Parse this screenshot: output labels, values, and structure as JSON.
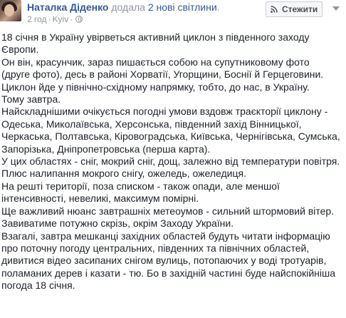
{
  "post": {
    "author": "Наталка Діденко",
    "action": " додала ",
    "photos_link": "2 нові світлини",
    "action_suffix": ".",
    "time": "2 год",
    "location": "Kyiv",
    "follow_label": "Стежити",
    "icons": {
      "avatar": "avatar-photo",
      "privacy": "globe-icon",
      "follow": "rss-icon",
      "more": "chevron-down-icon"
    },
    "colors": {
      "author_link": "#365899",
      "meta": "#90949c",
      "text": "#1d2129"
    },
    "paragraphs": [
      "18 січня в Україну увірветься активний циклон з південного заходу\nЄвропи.",
      "Он він, красунчик, зараз пишається собою на супутниковому фото\n(друге фото), десь в районі Хорватії, Угорщини, Боснії й Герцеговини.",
      "Циклон йде у північно-східному напрямку, тобто, до нас, в Україну.",
      "Тому завтра.",
      "Найскладнішими очікується погодні умови вздовж траєкторії циклону -\nОдеська, Миколаївська, Херсонська, південний захід Вінницької,\nЧеркаська, Полтавська, Кіровоградська, Київська, Чернігівська, Сумська,\nЗапорізька, Дніпропетровська (перша карта).",
      "У цих областях - сніг, мокрий сніг, дощ, залежно від температури повітря.",
      "Плюс налипання мокрого снігу, ожеледь, ожеледиця.",
      "На решті території, поза списком - також опади, але меншої\nінтенсивності, невеликі, максимум помірні.",
      "Ще важливий нюанс завтрашніх метеоумов - сильний штормовий вітер.",
      "Завиватиме потужно скрізь, окрім Заходу України.",
      "Взагалі, завтра мешканці західних областей будуть читати інформацію\nпро поточну погоду центральних, південних та північних областей,\nдивитися відео засипаних снігом вулиць, потопаючих у воді тротуарів,\nполаманих дерев і казати - тю. Бо в західній частині буде найспокійніша\nпогода 18 січня."
    ]
  }
}
